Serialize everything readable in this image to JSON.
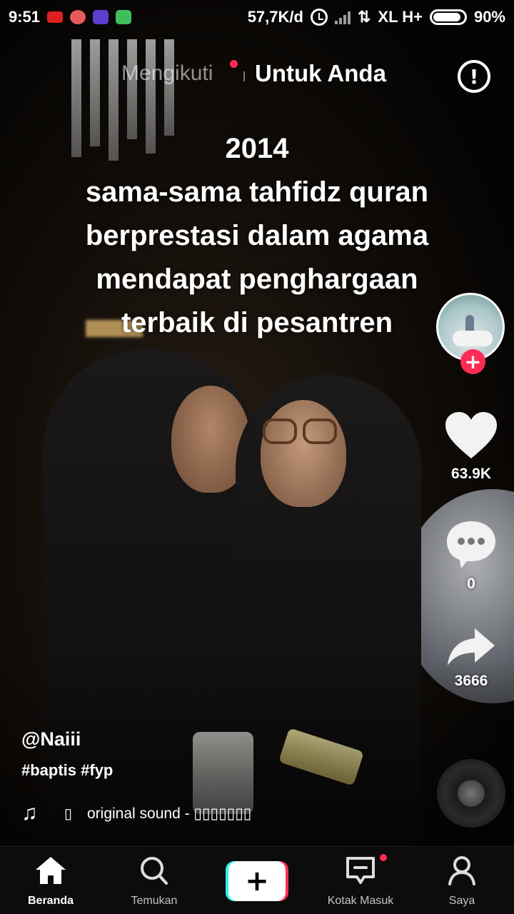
{
  "status_bar": {
    "time": "9:51",
    "net_speed": "57,7K/d",
    "carrier": "XL H+",
    "battery": "90%",
    "battery_level": 0.9
  },
  "tabs": {
    "following": "Mengikuti",
    "for_you": "Untuk Anda",
    "live_icon": "!"
  },
  "video": {
    "caption_lines": [
      "2014",
      "sama-sama tahfidz quran",
      "berprestasi dalam agama",
      "mendapat penghargaan",
      "terbaik di pesantren"
    ],
    "author": "@Naiii",
    "hashtags": "#baptis #fyp",
    "sound_icon_box": "▯",
    "sound": "original sound - ▯▯▯▯▯▯▯"
  },
  "actions": {
    "follow_symbol": "+",
    "likes": "63.9K",
    "comments": "0",
    "shares": "3666"
  },
  "nav": {
    "home": "Beranda",
    "discover": "Temukan",
    "create_symbol": "+",
    "inbox": "Kotak Masuk",
    "me": "Saya"
  },
  "colors": {
    "accent_red": "#fe2c55",
    "accent_cyan": "#25f4ee"
  },
  "icons": [
    "youtube-icon",
    "app-icon-red",
    "app-icon-purple",
    "app-icon-green",
    "alarm-icon",
    "signal-icon",
    "data-arrows-icon",
    "battery-icon",
    "live-alert-icon",
    "heart-icon",
    "comment-icon",
    "share-icon",
    "music-note-icon",
    "music-disc-icon",
    "home-icon",
    "search-icon",
    "create-icon",
    "inbox-icon",
    "profile-icon"
  ]
}
